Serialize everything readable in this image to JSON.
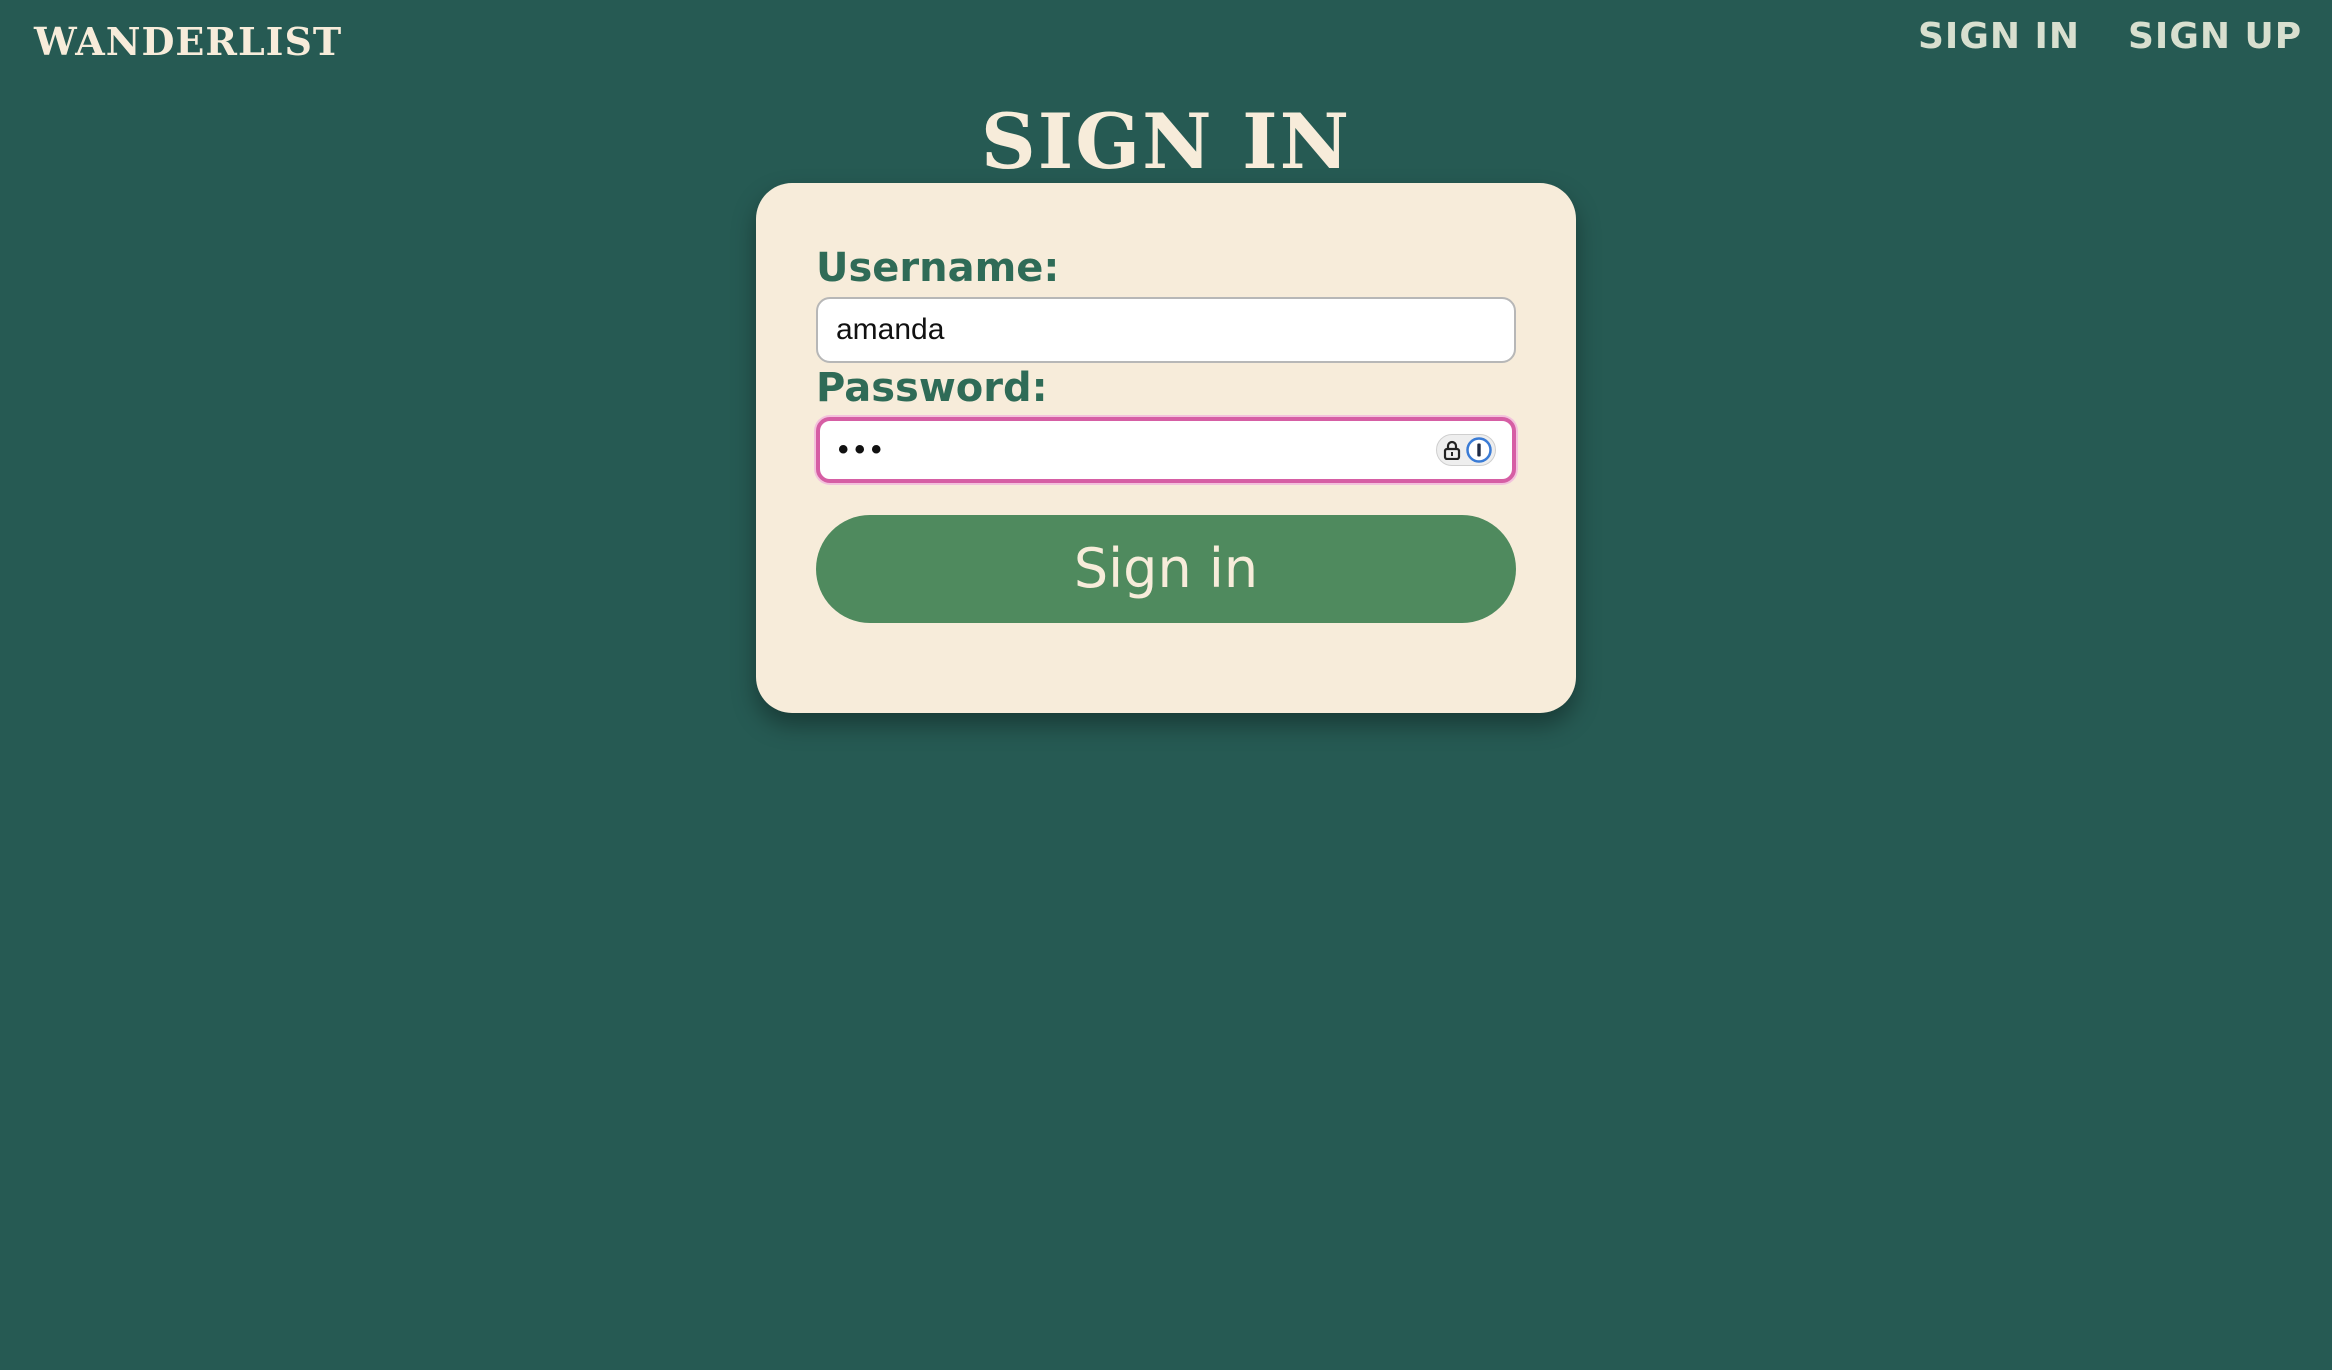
{
  "header": {
    "brand": "wanderlist",
    "nav": {
      "sign_in": "Sign in",
      "sign_up": "Sign up"
    }
  },
  "page": {
    "title": "Sign in"
  },
  "form": {
    "username_label": "Username:",
    "username_value": "amanda",
    "password_label": "Password:",
    "password_mask": "•••",
    "submit_label": "Sign in"
  },
  "colors": {
    "background": "#265a53",
    "card": "#f7ecda",
    "accent": "#4f8a5e",
    "label": "#2f6b57",
    "focus_ring": "#d65ea4"
  },
  "icons": {
    "lock": "lock-icon",
    "password_manager": "password-manager-icon"
  }
}
